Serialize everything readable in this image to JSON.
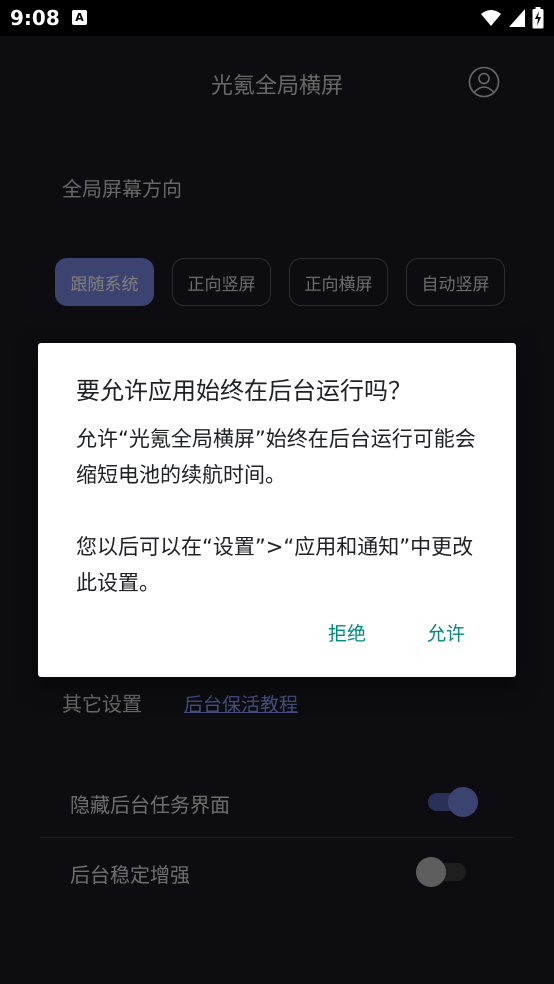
{
  "status_bar": {
    "time": "9:08",
    "notification_icon": "A"
  },
  "app": {
    "title": "光氪全局横屏",
    "orientation_section_title": "全局屏幕方向",
    "orientation_options": [
      {
        "label": "跟随系统",
        "selected": true
      },
      {
        "label": "正向竖屏",
        "selected": false
      },
      {
        "label": "正向横屏",
        "selected": false
      },
      {
        "label": "自动竖屏",
        "selected": false
      }
    ],
    "other_settings_title": "其它设置",
    "keep_alive_link": "后台保活教程",
    "toggles": [
      {
        "label": "隐藏后台任务界面",
        "on": true
      },
      {
        "label": "后台稳定增强",
        "on": false
      }
    ],
    "accent_color": "#7b86e0"
  },
  "dialog": {
    "title": "要允许应用始终在后台运行吗？",
    "body_line1": "允许“光氪全局横屏”始终在后台运行可能会缩短电池的续航时间。",
    "body_line2": "您以后可以在“设置”>“应用和通知”中更改此设置。",
    "deny_label": "拒绝",
    "allow_label": "允许",
    "button_color": "#00897b"
  }
}
